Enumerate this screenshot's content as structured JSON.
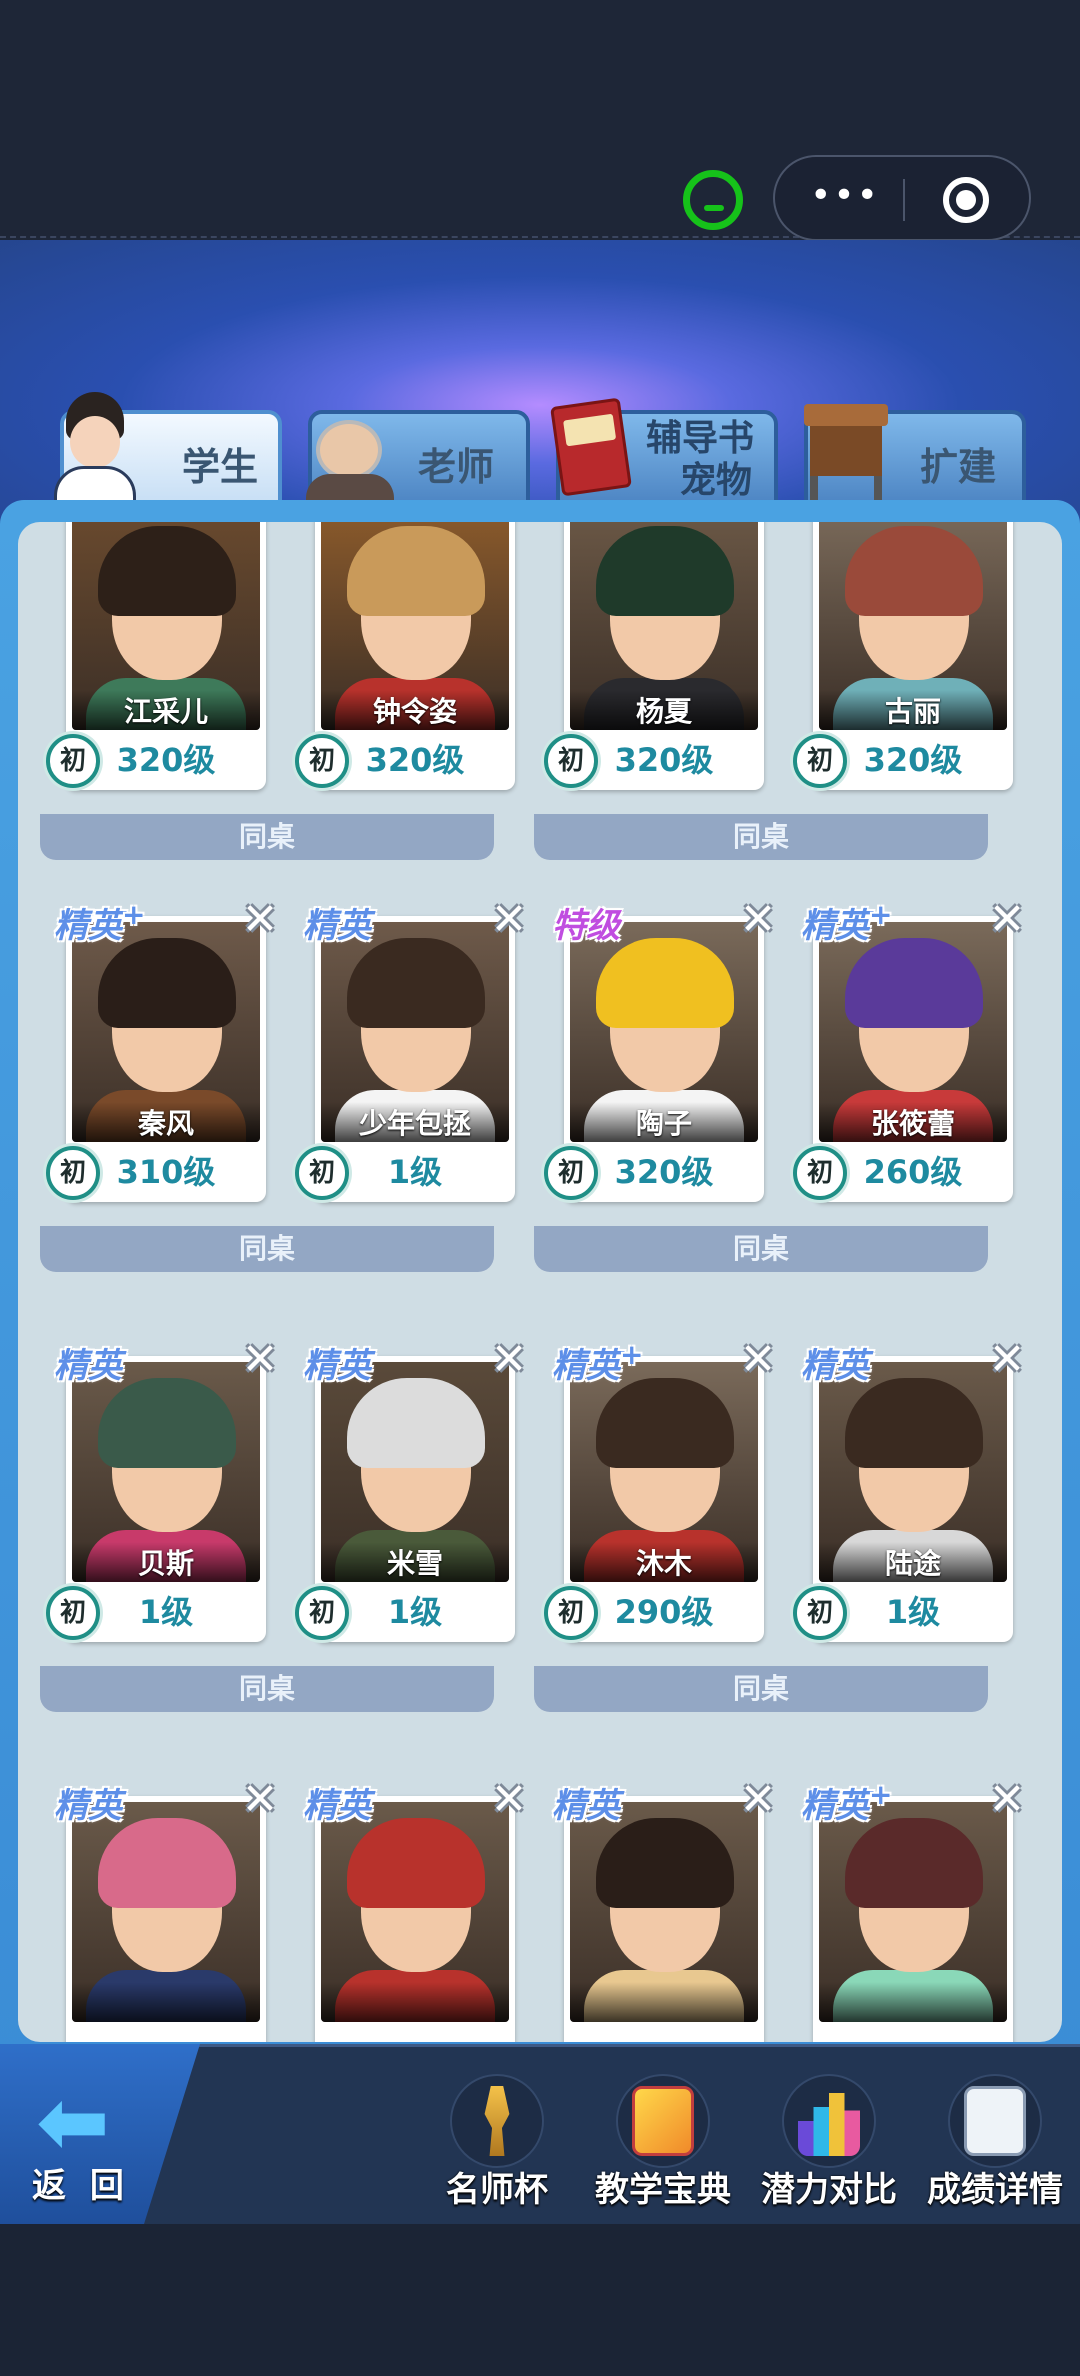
{
  "tabs": [
    {
      "label": "学生",
      "active": true
    },
    {
      "label": "老师",
      "active": false
    },
    {
      "label": "辅导书",
      "label2": "宠物",
      "active": false
    },
    {
      "label": "扩建",
      "active": false
    }
  ],
  "desk_label": "同桌",
  "grade_badge": "初",
  "students": [
    {
      "name": "江采儿",
      "level": "320级",
      "rank": "",
      "removable": false
    },
    {
      "name": "钟令姿",
      "level": "320级",
      "rank": "",
      "removable": false
    },
    {
      "name": "杨夏",
      "level": "320级",
      "rank": "",
      "removable": false
    },
    {
      "name": "古丽",
      "level": "320级",
      "rank": "",
      "removable": false
    },
    {
      "name": "秦风",
      "level": "310级",
      "rank": "精英",
      "plus": true,
      "removable": true
    },
    {
      "name": "少年包拯",
      "level": "1级",
      "rank": "精英",
      "plus": false,
      "removable": true
    },
    {
      "name": "陶子",
      "level": "320级",
      "rank": "特级",
      "plus": false,
      "removable": true
    },
    {
      "name": "张筱蕾",
      "level": "260级",
      "rank": "精英",
      "plus": true,
      "removable": true
    },
    {
      "name": "贝斯",
      "level": "1级",
      "rank": "精英",
      "plus": false,
      "removable": true
    },
    {
      "name": "米雪",
      "level": "1级",
      "rank": "精英",
      "plus": false,
      "removable": true
    },
    {
      "name": "沐木",
      "level": "290级",
      "rank": "精英",
      "plus": true,
      "removable": true
    },
    {
      "name": "陆途",
      "level": "1级",
      "rank": "精英",
      "plus": false,
      "removable": true
    },
    {
      "name": "",
      "level": "",
      "rank": "精英",
      "plus": false,
      "removable": true
    },
    {
      "name": "",
      "level": "",
      "rank": "精英",
      "plus": false,
      "removable": true
    },
    {
      "name": "",
      "level": "",
      "rank": "精英",
      "plus": false,
      "removable": true
    },
    {
      "name": "",
      "level": "",
      "rank": "精英",
      "plus": true,
      "removable": true
    }
  ],
  "bottom_nav": {
    "back": "返 回",
    "buttons": [
      "名师杯",
      "教学宝典",
      "潜力对比",
      "成绩详情"
    ]
  },
  "icons": {
    "close": "✕",
    "back": "arrow-left-icon",
    "chat": "chat-icon",
    "more": "more-dots-icon",
    "target": "record-target-icon"
  },
  "colors": {
    "accent": "#3b8dd6",
    "level_text": "#1e8aa0",
    "elite_rank": "#5d8fe8",
    "special_rank": "#c04de0"
  }
}
